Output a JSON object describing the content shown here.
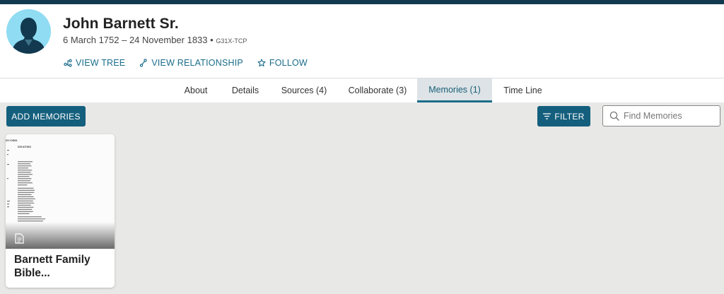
{
  "colors": {
    "top_bar": "#12394f",
    "accent": "#1a6d8a",
    "button_bg": "#145f7d",
    "avatar_bg": "#8fdcf3",
    "page_bg": "#e8e8e6"
  },
  "person": {
    "name": "John Barnett Sr.",
    "dates": "6 March 1752 – 24 November 1833 •",
    "pid": "G31X-TCP",
    "avatar_icon": "person-silhouette-icon"
  },
  "actions": [
    {
      "label": "VIEW TREE",
      "icon": "tree-icon"
    },
    {
      "label": "VIEW RELATIONSHIP",
      "icon": "relationship-icon"
    },
    {
      "label": "FOLLOW",
      "icon": "star-icon"
    }
  ],
  "tabs": [
    {
      "label": "About"
    },
    {
      "label": "Details"
    },
    {
      "label": "Sources (4)"
    },
    {
      "label": "Collaborate (3)"
    },
    {
      "label": "Memories (1)",
      "active": true
    },
    {
      "label": "Time Line"
    }
  ],
  "toolbar": {
    "add_label": "ADD MEMORIES",
    "filter_label": "FILTER",
    "search_placeholder": "Find Memories"
  },
  "memories": [
    {
      "title": "Barnett Family Bible...",
      "type_icon": "document-icon",
      "thumb_heading": "ECORD",
      "thumb_subheading": "DEATHS"
    }
  ]
}
